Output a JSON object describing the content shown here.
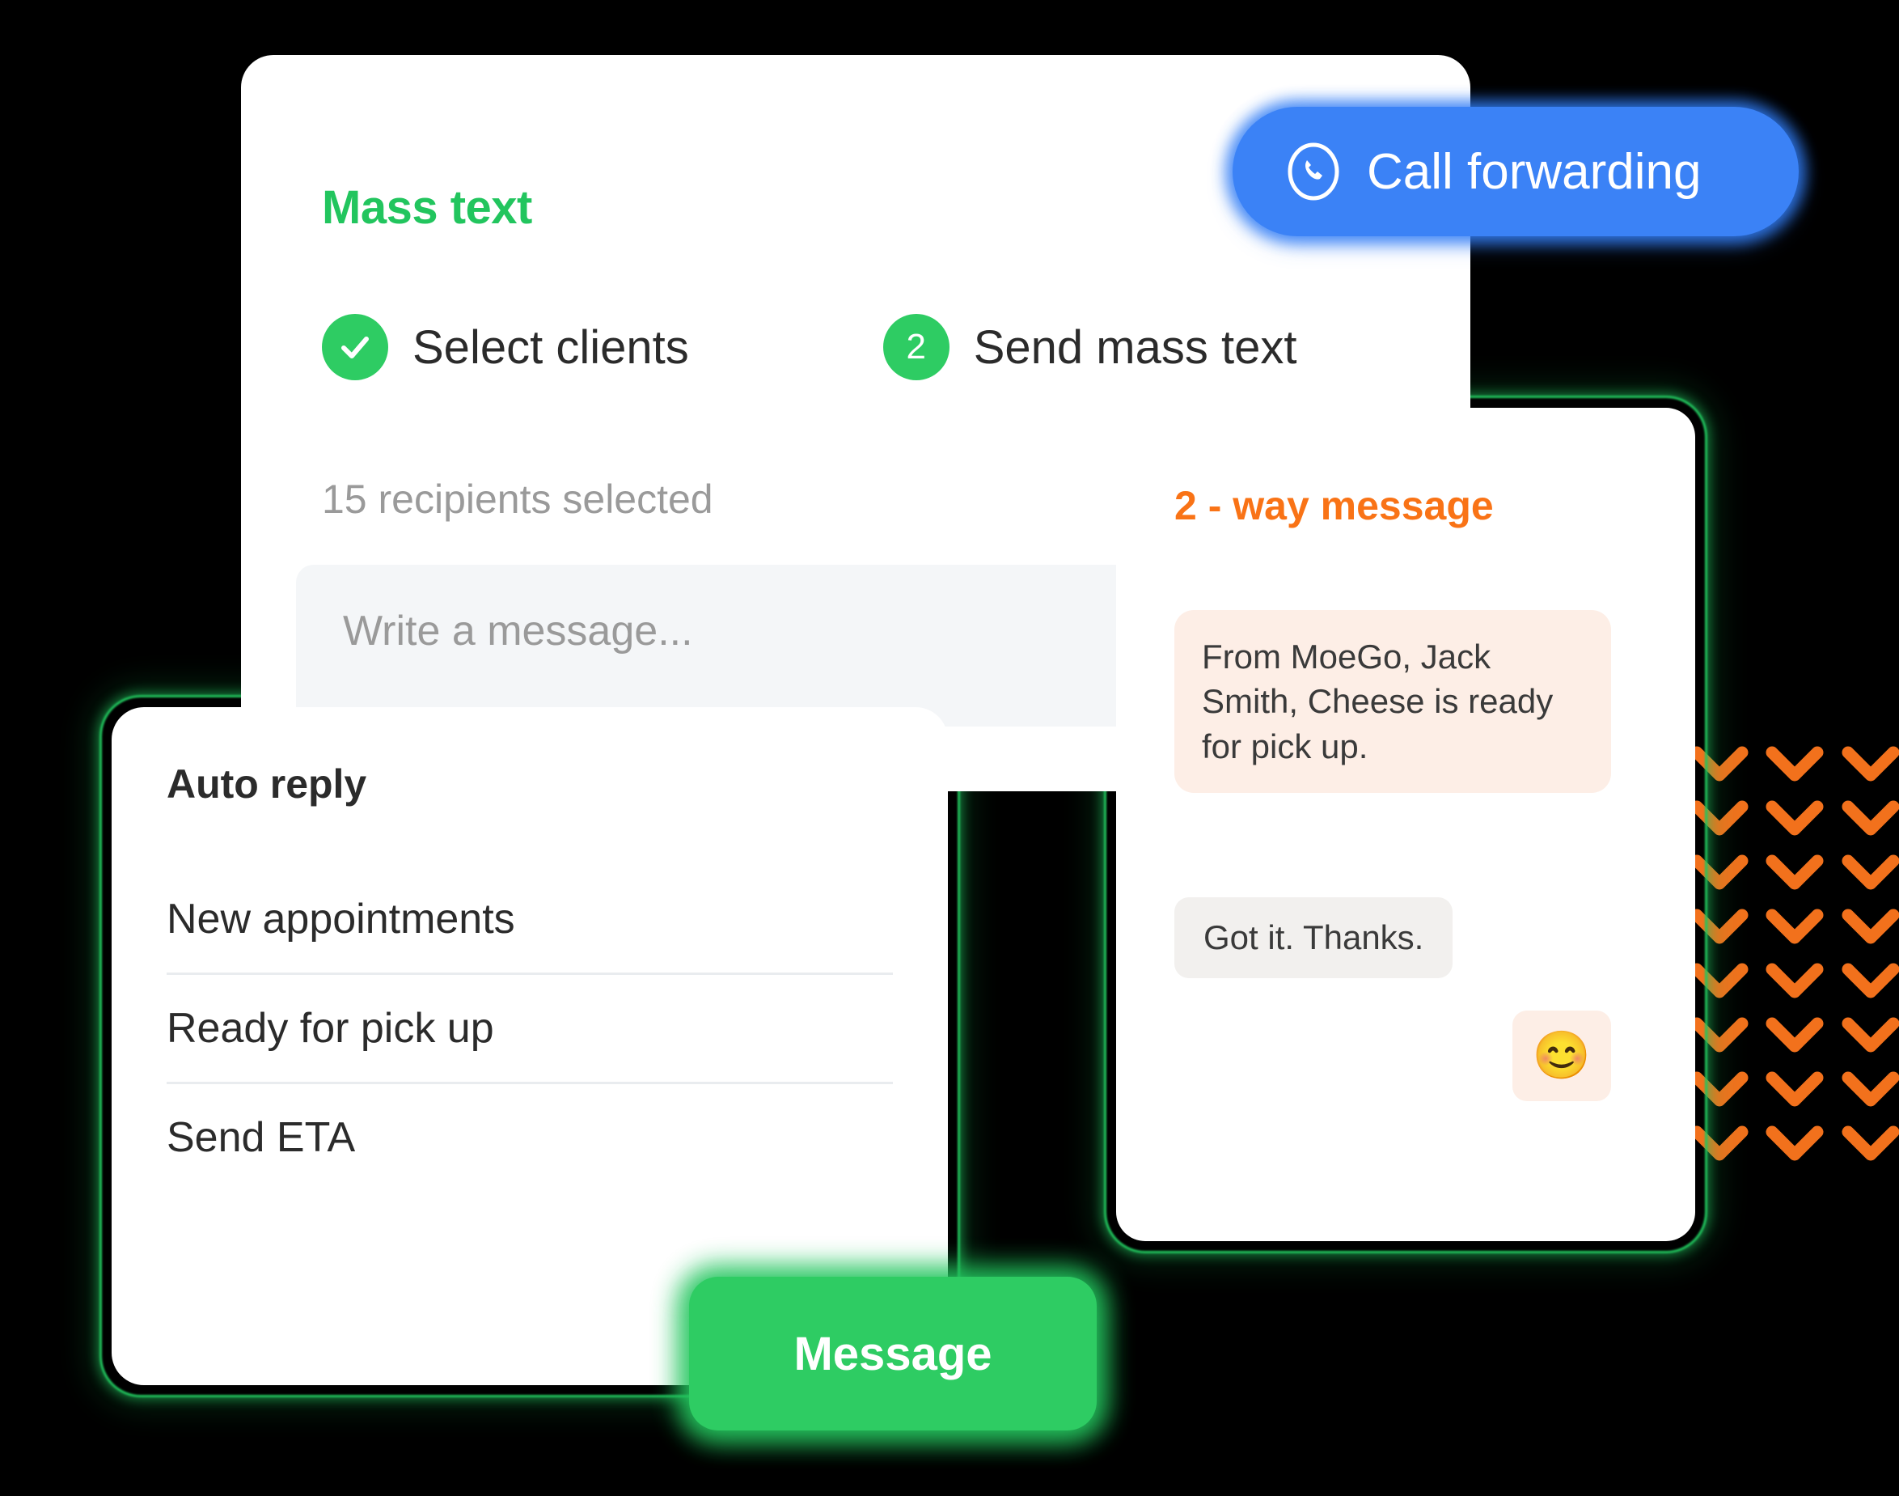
{
  "mass_text": {
    "title": "Mass text",
    "steps": [
      {
        "badge_icon": "check-icon",
        "badge_value": "",
        "label": "Select clients",
        "state": "complete"
      },
      {
        "badge_icon": "",
        "badge_value": "2",
        "label": "Send mass text",
        "state": "active"
      }
    ],
    "recipients_status": "15 recipients selected",
    "message_placeholder": "Write a message..."
  },
  "call_forwarding": {
    "icon": "phone-circle-icon",
    "label": "Call forwarding"
  },
  "auto_reply": {
    "title": "Auto reply",
    "items": [
      "New appointments",
      "Ready for pick up",
      "Send ETA"
    ]
  },
  "two_way_message": {
    "title": "2 - way message",
    "outgoing": "From MoeGo, Jack Smith, Cheese is ready for pick up.",
    "incoming": "Got it. Thanks.",
    "reaction_emoji": "😊"
  },
  "message_button": {
    "label": "Message"
  },
  "decor": {
    "chevron_icon": "chevron-down-icon",
    "chevron_count": 24
  },
  "colors": {
    "background": "#000000",
    "card": "#ffffff",
    "green": "#2ecc63",
    "green_title": "#22c55e",
    "blue": "#3b82f6",
    "orange": "#f97316",
    "bubble_peach": "#fdeee6",
    "bubble_grey": "#f2f0ee",
    "input_grey": "#f4f6f8",
    "muted_text": "#9a9a9a",
    "dark_text": "#2b2b2b"
  }
}
